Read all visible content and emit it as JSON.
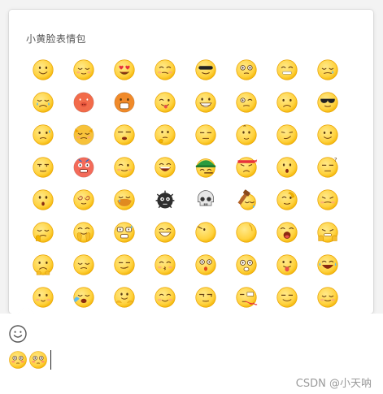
{
  "panel": {
    "title": "小黄脸表情包"
  },
  "emojis": [
    "smile",
    "shy",
    "heart-eyes",
    "tipsy",
    "cool",
    "dizzy-eyes",
    "zipped",
    "weep",
    "sob",
    "pig-face",
    "jaw-drop",
    "tongue-wink",
    "grin-teeth",
    "squint-one",
    "frown",
    "sunglasses",
    "sweat",
    "angry-cat",
    "sleepy",
    "thinking",
    "meh",
    "doubt",
    "smirk",
    "happy",
    "stare",
    "furious",
    "wink-blush",
    "laugh",
    "green-hat",
    "headband",
    "surprised",
    "question",
    "shock",
    "swirl-eyes",
    "cry-hide",
    "virus",
    "skull",
    "hammer",
    "salute",
    "grimace",
    "cold",
    "clap",
    "scared-sweat",
    "drool-smile",
    "peek",
    "yawn",
    "eat",
    "fist",
    "sad",
    "tired",
    "sly",
    "kiss",
    "stunned",
    "crazy",
    "tongue-out",
    "laugh-cry",
    "pout",
    "rage-cry",
    "hug",
    "blush",
    "glance",
    "bleed",
    "snicker",
    "calm"
  ],
  "input": {
    "emojis": [
      "flushed",
      "flushed"
    ]
  },
  "icons": {
    "toggle": "smiley-outline-icon"
  },
  "watermark": "CSDN @小天呐",
  "colors": {
    "face": "#ffd23f",
    "face_edge": "#e8a200",
    "accent": "#e0481c",
    "background": "#f3f3f3"
  }
}
